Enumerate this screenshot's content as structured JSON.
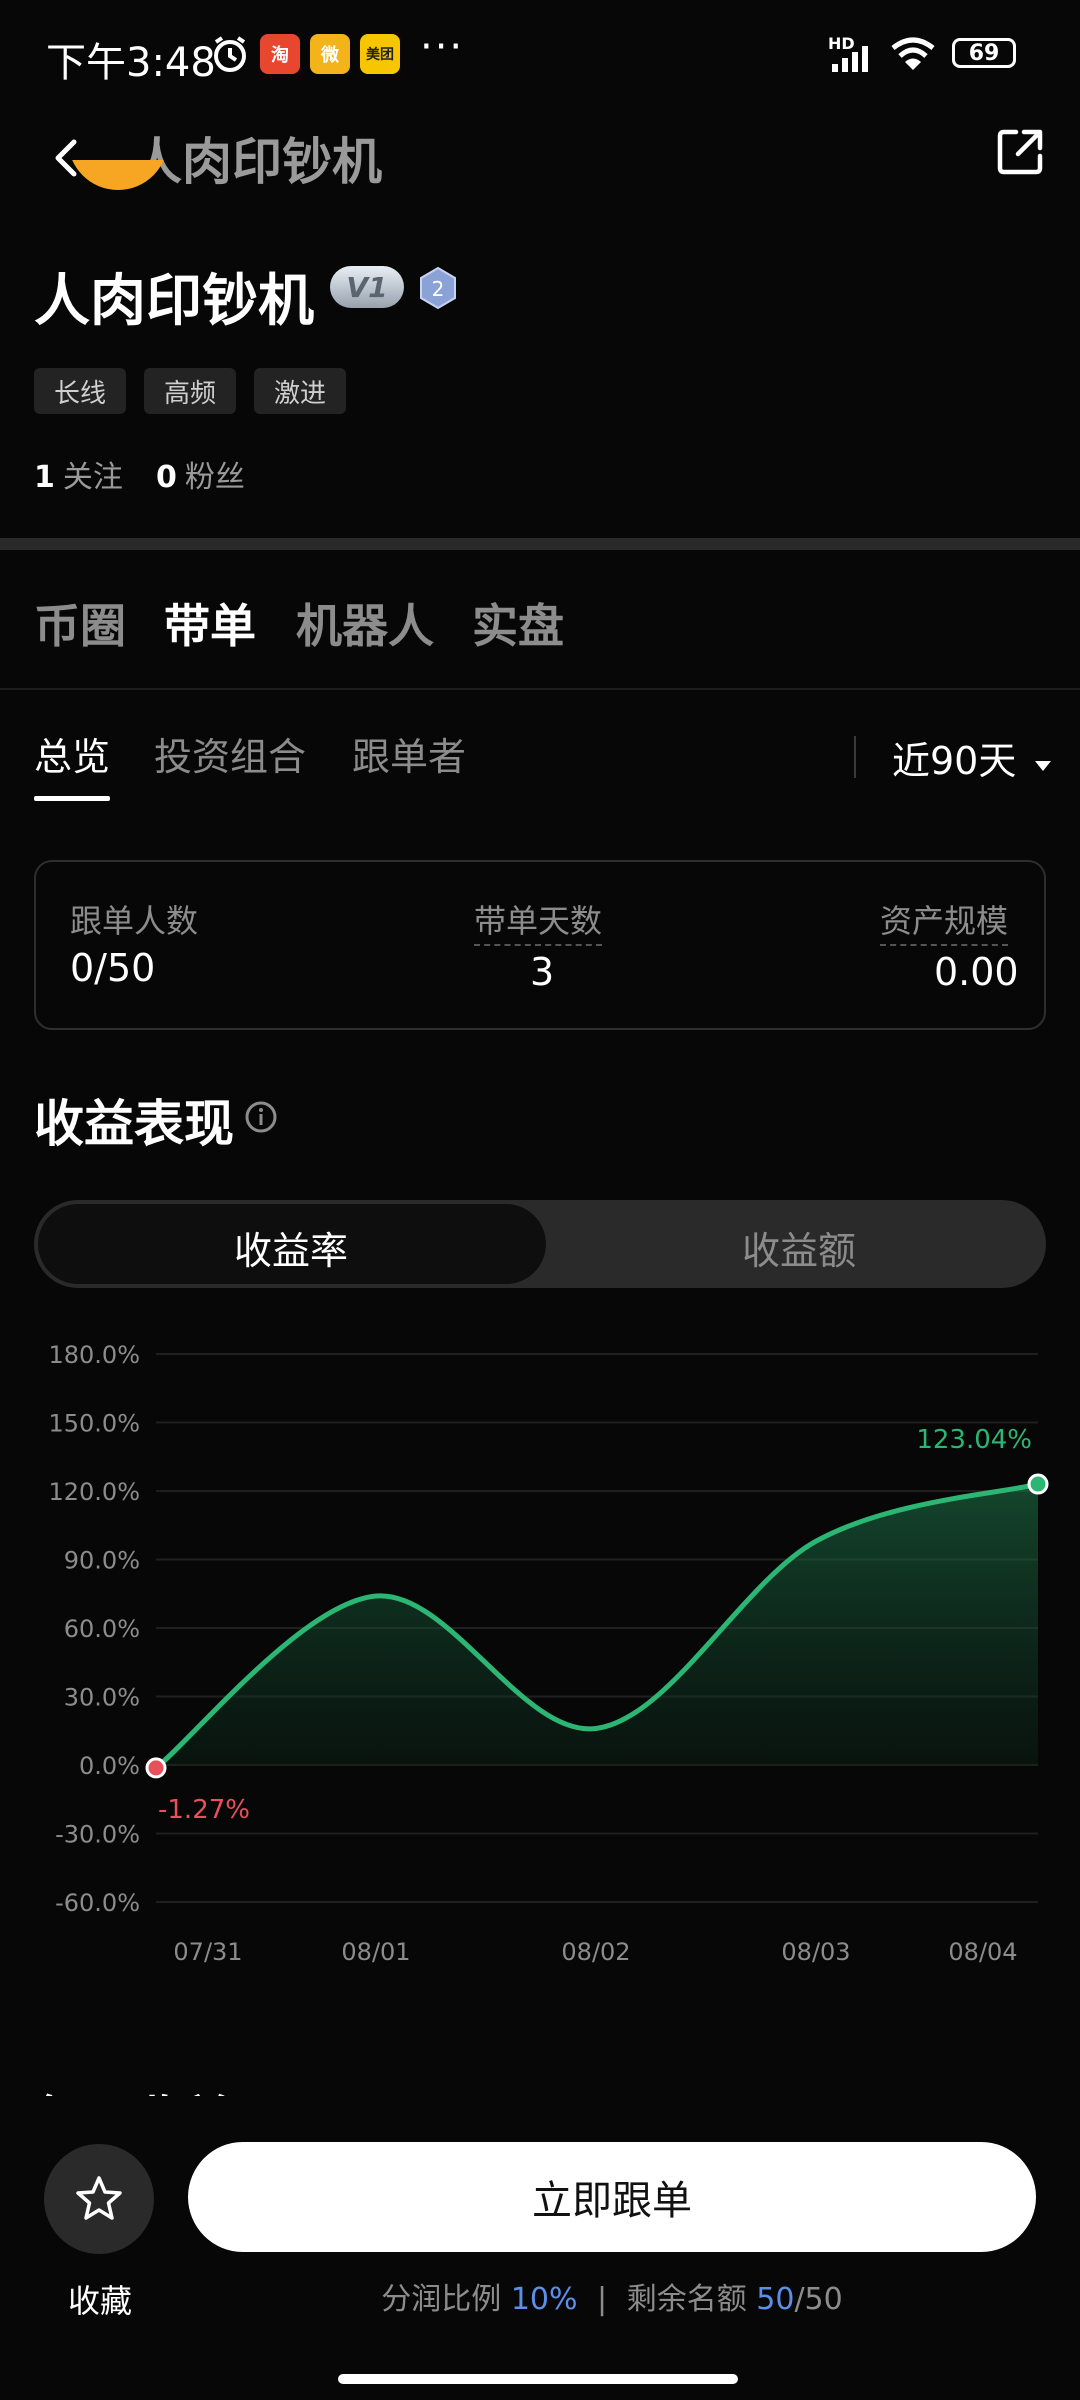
{
  "status_bar": {
    "time": "下午3:48",
    "app_icons": [
      "淘",
      "微",
      "美团"
    ],
    "more": "···",
    "network": "HD",
    "battery": "69"
  },
  "nav": {
    "title": "人肉印钞机"
  },
  "profile": {
    "name": "人肉印钞机",
    "vip_badge": "V1",
    "level_badge": "2",
    "tags": [
      "长线",
      "高频",
      "激进"
    ],
    "following_count": "1",
    "following_label": "关注",
    "followers_count": "0",
    "followers_label": "粉丝"
  },
  "main_tabs": [
    {
      "label": "币圈",
      "active": false
    },
    {
      "label": "带单",
      "active": true
    },
    {
      "label": "机器人",
      "active": false
    },
    {
      "label": "实盘",
      "active": false
    }
  ],
  "sub_tabs": [
    {
      "label": "总览",
      "active": true
    },
    {
      "label": "投资组合",
      "active": false
    },
    {
      "label": "跟单者",
      "active": false
    }
  ],
  "range_select": {
    "label": "近90天",
    "icon": "caret-down-icon"
  },
  "stats": [
    {
      "label": "跟单人数",
      "value": "0/50"
    },
    {
      "label": "带单天数",
      "value": "3"
    },
    {
      "label": "资产规模",
      "value": "0.00"
    }
  ],
  "performance": {
    "title": "收益表现",
    "toggle": [
      "收益率",
      "收益额"
    ],
    "active_toggle": "收益率"
  },
  "chart_data": {
    "type": "area",
    "categories": [
      "07/31",
      "08/01",
      "08/02",
      "08/03",
      "08/04"
    ],
    "y_ticks": [
      "180.0%",
      "150.0%",
      "120.0%",
      "90.0%",
      "60.0%",
      "30.0%",
      "0.0%",
      "-30.0%",
      "-60.0%"
    ],
    "ylim": [
      -60,
      180
    ],
    "series": [
      {
        "points": [
          {
            "x": "07/31",
            "y": -1.27
          },
          {
            "x": "08/01",
            "y": 74
          },
          {
            "x": "08/02",
            "y": 16
          },
          {
            "x": "08/03",
            "y": 98
          },
          {
            "x": "08/04",
            "y": 123.04
          }
        ]
      }
    ],
    "annotations": [
      {
        "x": "07/31",
        "y": -1.27,
        "text": "-1.27%",
        "color": "#e8505b"
      },
      {
        "x": "08/04",
        "y": 123.04,
        "text": "123.04%",
        "color": "#2bb673"
      }
    ],
    "line_color": "#2bb673",
    "grid": true
  },
  "next_section": {
    "title": "每日收益"
  },
  "bottom": {
    "favorite_label": "收藏",
    "follow_button": "立即跟单",
    "profit_share_label": "分润比例",
    "profit_share_value": "10%",
    "separator": "|",
    "remaining_label": "剩余名额",
    "remaining_value": "50",
    "remaining_total": "/50"
  }
}
